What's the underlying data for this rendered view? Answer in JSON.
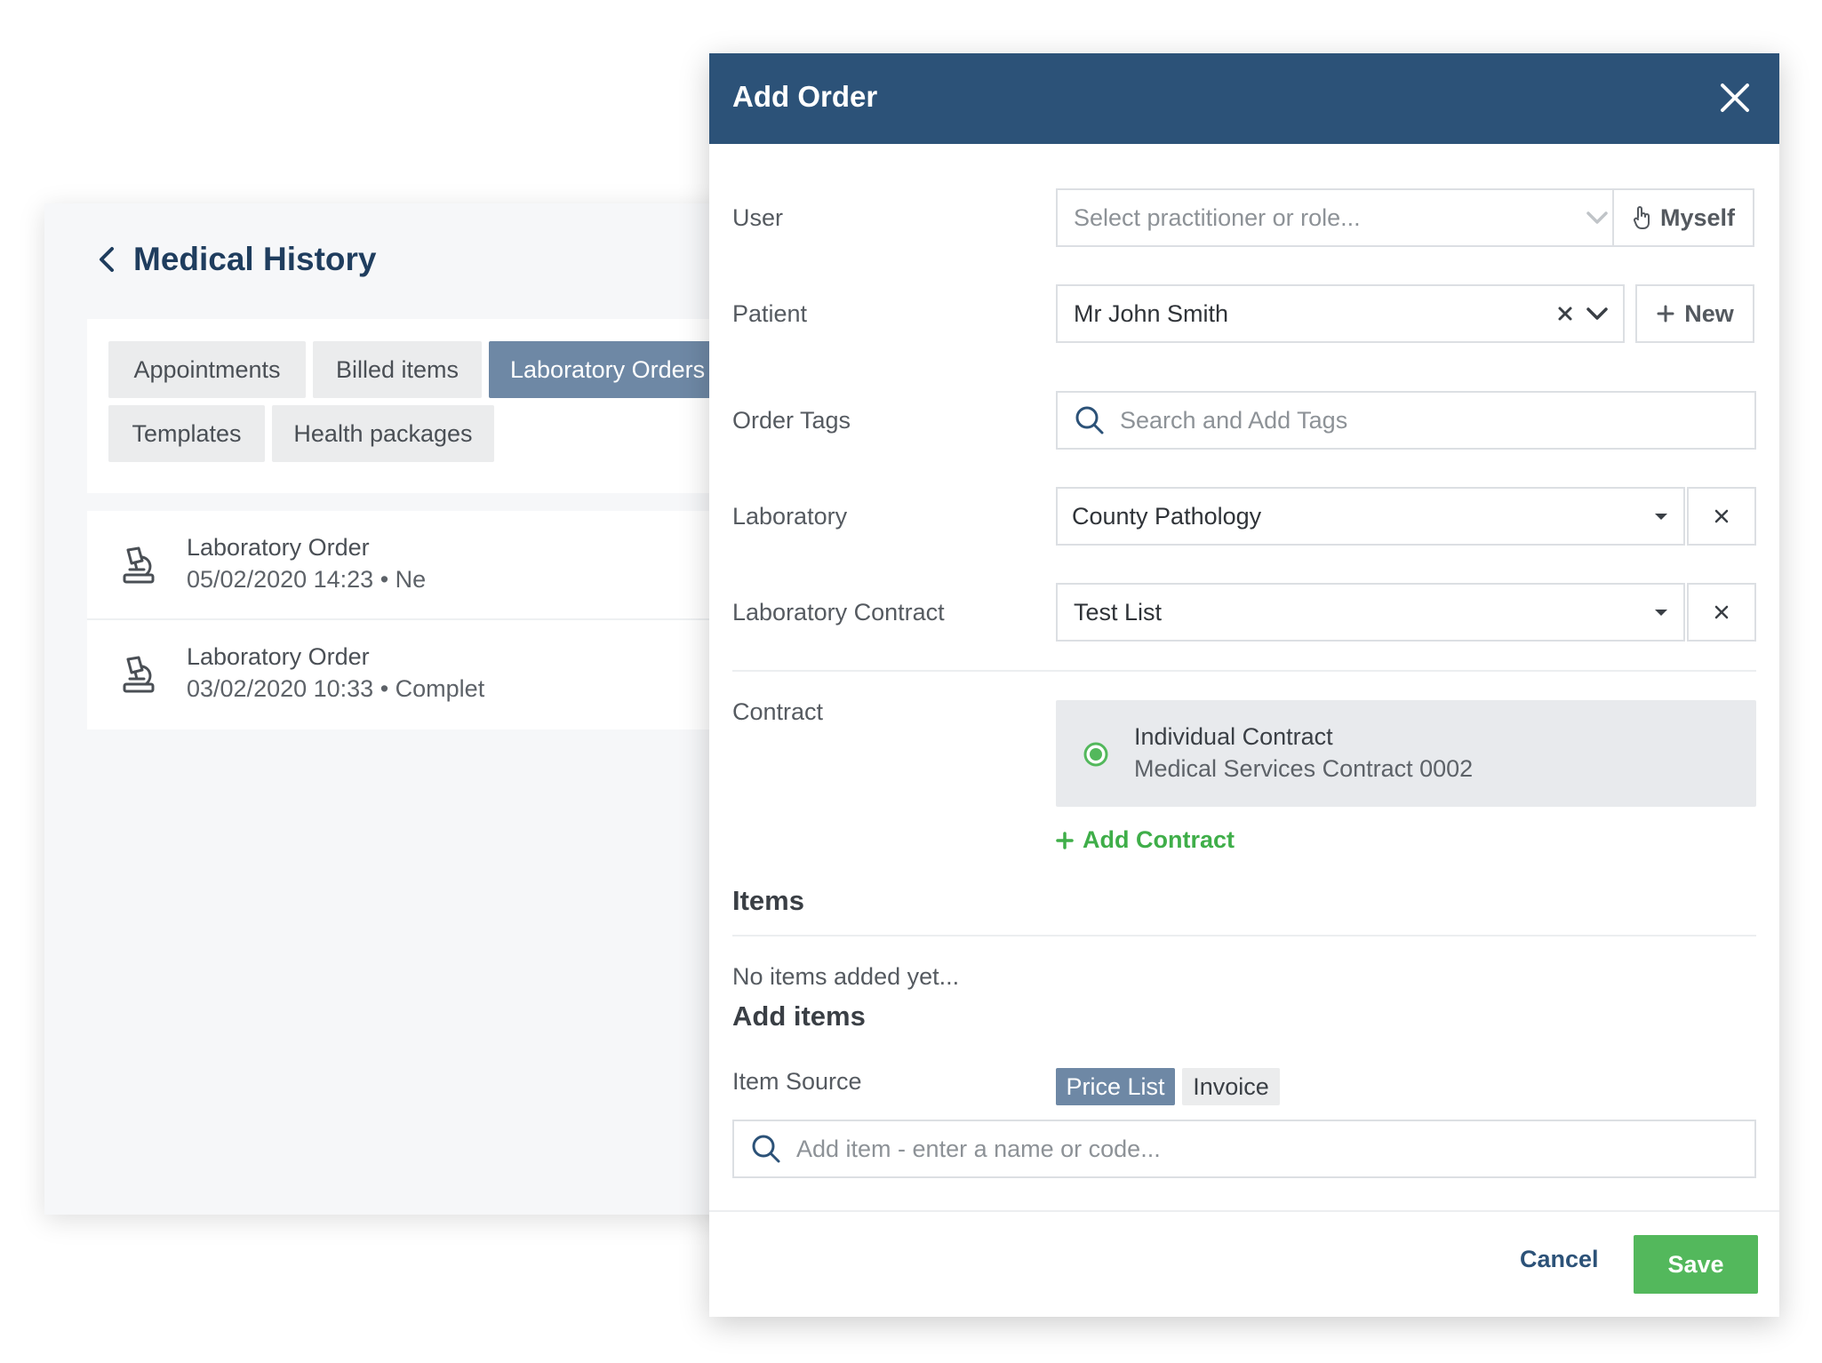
{
  "history": {
    "title": "Medical History",
    "tabs": [
      {
        "label": "Appointments",
        "active": false
      },
      {
        "label": "Billed items",
        "active": false
      },
      {
        "label": "Laboratory Orders",
        "active": true
      },
      {
        "label": "Templates",
        "active": false
      },
      {
        "label": "Health packages",
        "active": false
      }
    ],
    "orders": [
      {
        "title": "Laboratory Order",
        "meta": "05/02/2020 14:23 • Ne"
      },
      {
        "title": "Laboratory Order",
        "meta": "03/02/2020 10:33 • Complet"
      }
    ]
  },
  "modal": {
    "title": "Add Order",
    "user": {
      "label": "User",
      "placeholder": "Select practitioner or role...",
      "myself_label": "Myself"
    },
    "patient": {
      "label": "Patient",
      "value": "Mr John Smith",
      "new_label": "New"
    },
    "order_tags": {
      "label": "Order Tags",
      "placeholder": "Search and Add Tags"
    },
    "laboratory": {
      "label": "Laboratory",
      "value": "County Pathology"
    },
    "laboratory_contract": {
      "label": "Laboratory Contract",
      "value": "Test List"
    },
    "contract": {
      "label": "Contract",
      "name": "Individual Contract",
      "detail": "Medical Services Contract 0002",
      "add_label": "Add Contract"
    },
    "items": {
      "title": "Items",
      "empty": "No items added yet..."
    },
    "add_items": {
      "title": "Add items",
      "source_label": "Item Source",
      "sources": [
        {
          "label": "Price List",
          "active": true
        },
        {
          "label": "Invoice",
          "active": false
        }
      ],
      "search_placeholder": "Add item - enter a name or code..."
    },
    "footer": {
      "cancel_label": "Cancel",
      "save_label": "Save"
    }
  },
  "colors": {
    "header": "#2c5278",
    "accent_green": "#53b85c",
    "tab_active": "#6e88a5"
  }
}
